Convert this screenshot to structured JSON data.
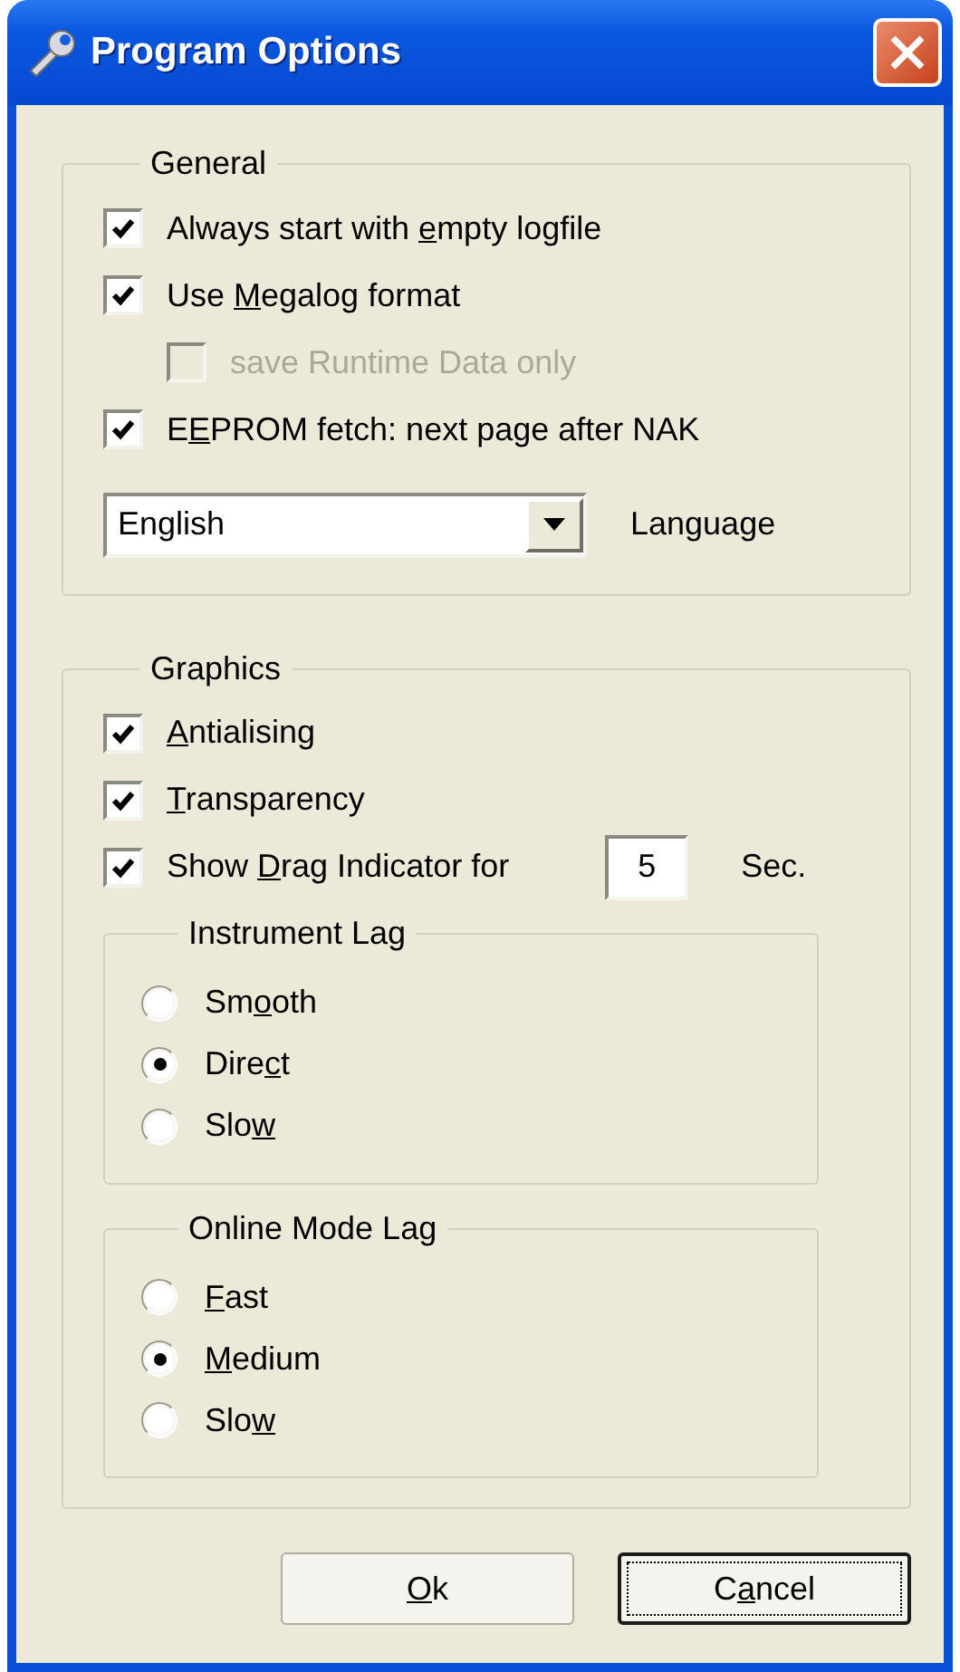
{
  "window": {
    "title": "Program Options"
  },
  "general": {
    "title": "General",
    "options": [
      {
        "pre": "Always start with ",
        "key": "e",
        "post": "mpty logfile",
        "checked": true,
        "disabled": false
      },
      {
        "pre": "Use ",
        "key": "M",
        "post": "egalog format",
        "checked": true,
        "disabled": false,
        "children": [
          {
            "pre": "save Runtime Data only",
            "checked": false,
            "disabled": true
          }
        ]
      },
      {
        "pre": "E",
        "key": "E",
        "post": "PROM fetch: next page after NAK",
        "checked": true,
        "disabled": false
      }
    ],
    "language": {
      "value": "English",
      "label": "Language"
    }
  },
  "graphics": {
    "title": "Graphics",
    "options": [
      {
        "key": "A",
        "post": "ntialising",
        "checked": true,
        "disabled": false
      },
      {
        "key": "T",
        "post": "ransparency",
        "checked": true,
        "disabled": false
      },
      {
        "pre": "Show ",
        "key": "D",
        "post": "rag Indicator for",
        "checked": true,
        "disabled": false,
        "seconds": {
          "value": "5",
          "unit": "Sec."
        }
      }
    ],
    "groups": [
      {
        "title": "Instrument Lag",
        "choices": [
          {
            "pre": "Sm",
            "key": "o",
            "post": "oth",
            "selected": false
          },
          {
            "pre": "Dire",
            "key": "c",
            "post": "t",
            "selected": true
          },
          {
            "pre": "Slo",
            "key": "w",
            "selected": false
          }
        ]
      },
      {
        "title": "Online Mode Lag",
        "choices": [
          {
            "key": "F",
            "post": "ast",
            "selected": false
          },
          {
            "key": "M",
            "post": "edium",
            "selected": true
          },
          {
            "pre": "Slo",
            "key": "w",
            "selected": false
          }
        ]
      }
    ]
  },
  "buttons": [
    {
      "key": "O",
      "post": "k",
      "focused": false
    },
    {
      "pre": "C",
      "key": "a",
      "post": "ncel",
      "focused": true
    }
  ]
}
